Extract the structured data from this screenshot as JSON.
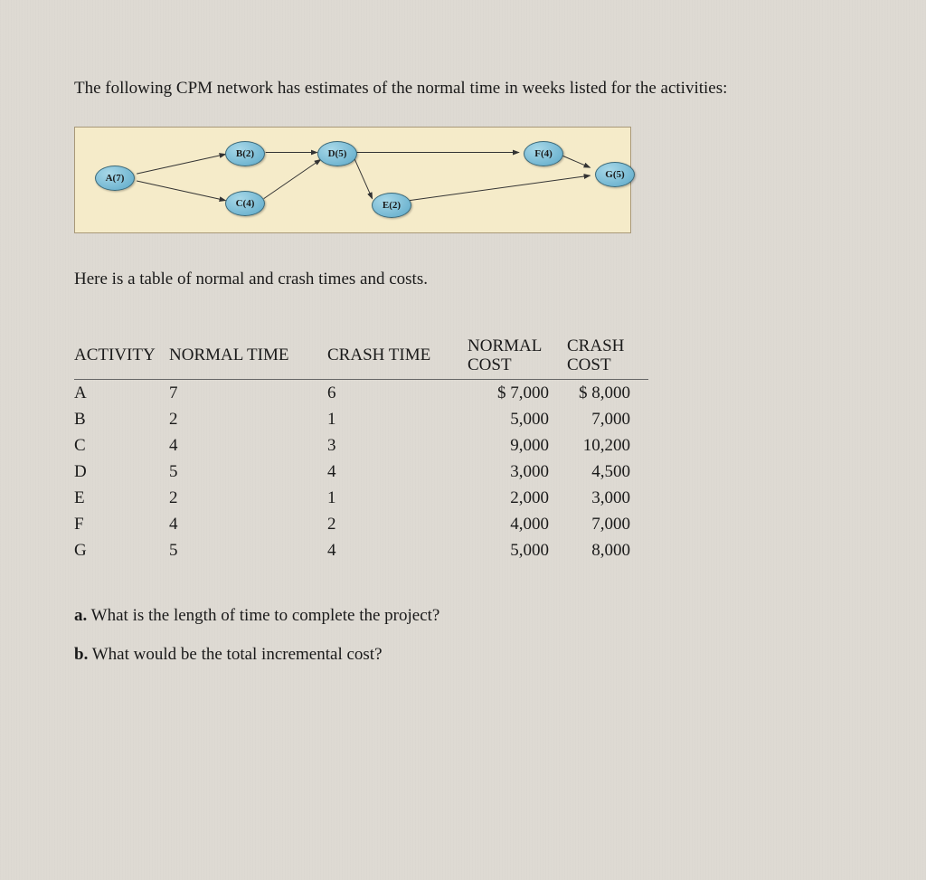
{
  "intro": "The following CPM network has estimates of the normal time in weeks listed for the activities:",
  "diagram": {
    "nodes": {
      "a": "A(7)",
      "b": "B(2)",
      "c": "C(4)",
      "d": "D(5)",
      "e": "E(2)",
      "f": "F(4)",
      "g": "G(5)"
    }
  },
  "subtitle": "Here is a table of normal and crash times and costs.",
  "table": {
    "headers": {
      "activity": "ACTIVITY",
      "normal_time": "NORMAL TIME",
      "crash_time": "CRASH TIME",
      "normal_cost": "NORMAL COST",
      "crash_cost": "CRASH COST"
    },
    "rows": [
      {
        "activity": "A",
        "normal_time": "7",
        "crash_time": "6",
        "normal_cost": "$ 7,000",
        "crash_cost": "$ 8,000"
      },
      {
        "activity": "B",
        "normal_time": "2",
        "crash_time": "1",
        "normal_cost": "5,000",
        "crash_cost": "7,000"
      },
      {
        "activity": "C",
        "normal_time": "4",
        "crash_time": "3",
        "normal_cost": "9,000",
        "crash_cost": "10,200"
      },
      {
        "activity": "D",
        "normal_time": "5",
        "crash_time": "4",
        "normal_cost": "3,000",
        "crash_cost": "4,500"
      },
      {
        "activity": "E",
        "normal_time": "2",
        "crash_time": "1",
        "normal_cost": "2,000",
        "crash_cost": "3,000"
      },
      {
        "activity": "F",
        "normal_time": "4",
        "crash_time": "2",
        "normal_cost": "4,000",
        "crash_cost": "7,000"
      },
      {
        "activity": "G",
        "normal_time": "5",
        "crash_time": "4",
        "normal_cost": "5,000",
        "crash_cost": "8,000"
      }
    ]
  },
  "questions": {
    "a": {
      "label": "a.",
      "text": "What is the length of time to complete the project?"
    },
    "b": {
      "label": "b.",
      "text": "What would be the total incremental cost?"
    }
  },
  "chart_data": {
    "type": "table",
    "title": "Normal and crash times and costs",
    "columns": [
      "ACTIVITY",
      "NORMAL TIME",
      "CRASH TIME",
      "NORMAL COST",
      "CRASH COST"
    ],
    "rows": [
      [
        "A",
        7,
        6,
        7000,
        8000
      ],
      [
        "B",
        2,
        1,
        5000,
        7000
      ],
      [
        "C",
        4,
        3,
        9000,
        10200
      ],
      [
        "D",
        5,
        4,
        3000,
        4500
      ],
      [
        "E",
        2,
        1,
        2000,
        3000
      ],
      [
        "F",
        4,
        2,
        4000,
        7000
      ],
      [
        "G",
        5,
        4,
        5000,
        8000
      ]
    ],
    "network_edges": [
      [
        "A",
        "B"
      ],
      [
        "A",
        "C"
      ],
      [
        "B",
        "D"
      ],
      [
        "C",
        "D"
      ],
      [
        "D",
        "F"
      ],
      [
        "D",
        "E"
      ],
      [
        "F",
        "G"
      ],
      [
        "E",
        "G"
      ]
    ]
  }
}
